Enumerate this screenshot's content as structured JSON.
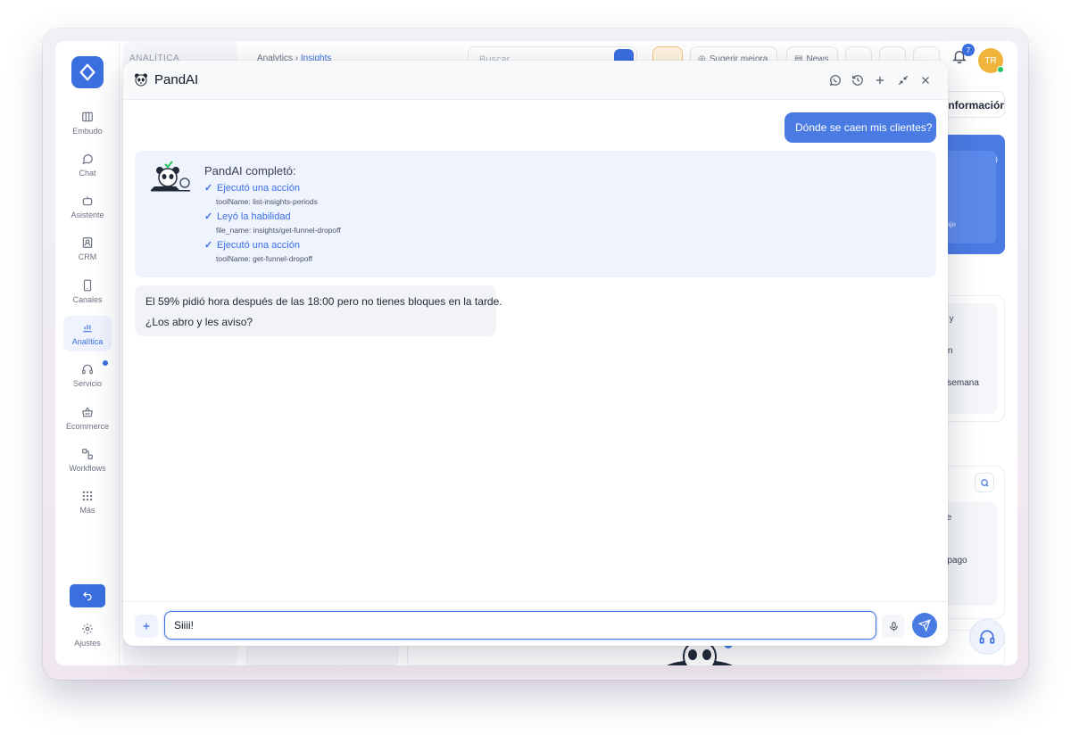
{
  "nav": {
    "items": [
      {
        "label": "Embudo",
        "icon": "columns-icon"
      },
      {
        "label": "Chat",
        "icon": "chat-bubble-icon"
      },
      {
        "label": "Asistente",
        "icon": "robot-icon"
      },
      {
        "label": "CRM",
        "icon": "contact-card-icon"
      },
      {
        "label": "Canales",
        "icon": "phone-icon"
      },
      {
        "label": "Analítica",
        "icon": "bar-chart-icon",
        "active": true
      },
      {
        "label": "Servicio",
        "icon": "headset-icon",
        "dot": true
      },
      {
        "label": "Ecommerce",
        "icon": "basket-icon"
      },
      {
        "label": "Workflows",
        "icon": "workflow-icon"
      },
      {
        "label": "Más",
        "icon": "grid-dots-icon"
      }
    ],
    "settings_label": "Ajustes"
  },
  "background": {
    "section_title": "ANALÍTICA",
    "breadcrumb": {
      "root": "Analytics",
      "current": "Insights"
    },
    "search_placeholder": "Buscar",
    "suggest_label": "Sugerir mejora",
    "news_label": "News",
    "notification_count": "7",
    "avatar_initials": "TR",
    "info_button": "Información",
    "blue_card_text": "nsaje",
    "snippets": [
      "s, y",
      "ron",
      "a semana",
      "ble",
      "o",
      "e pago"
    ]
  },
  "chat": {
    "title": "PandAI",
    "user_message": "Dónde se caen mis clientes?",
    "agent_title": "PandAI completó:",
    "steps": [
      {
        "label": "Ejecutó una acción",
        "detail": "toolName: list-insights-periods"
      },
      {
        "label": "Leyó la habilidad",
        "detail": "file_name: insights/get-funnel-dropoff"
      },
      {
        "label": "Ejecutó una acción",
        "detail": "toolName: get-funnel-dropoff"
      }
    ],
    "bot_lines": [
      "El 59% pidió hora después de las 18:00 pero no tienes bloques en la tarde.",
      "¿Los abro y les aviso?"
    ],
    "input_value": "Siiii!"
  },
  "colors": {
    "accent": "#3b6fe0",
    "user_bubble": "#4a7be3",
    "agent_box": "#eef3fd",
    "avatar": "#f0b43c"
  }
}
